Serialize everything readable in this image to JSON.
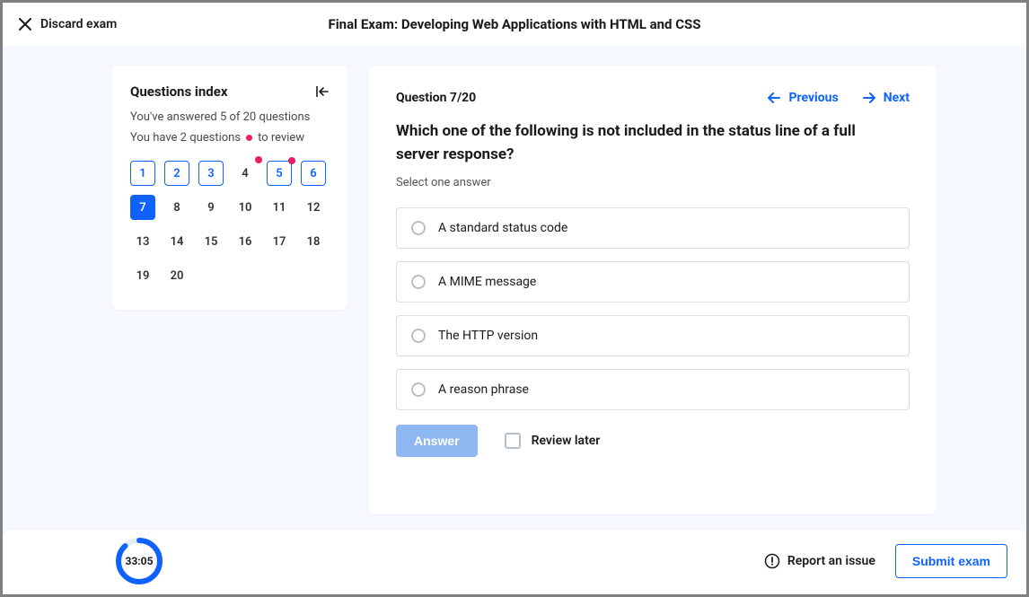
{
  "header": {
    "discard_label": "Discard exam",
    "title": "Final Exam: Developing Web Applications with HTML and CSS"
  },
  "sidebar": {
    "title": "Questions index",
    "progress_text": "You've answered 5 of 20 questions",
    "review_text_a": "You have 2 questions",
    "review_text_b": "to review",
    "cells": [
      {
        "n": "1",
        "answered": true,
        "current": false,
        "flag": false
      },
      {
        "n": "2",
        "answered": true,
        "current": false,
        "flag": false
      },
      {
        "n": "3",
        "answered": true,
        "current": false,
        "flag": false
      },
      {
        "n": "4",
        "answered": false,
        "current": false,
        "flag": true
      },
      {
        "n": "5",
        "answered": true,
        "current": false,
        "flag": true
      },
      {
        "n": "6",
        "answered": true,
        "current": false,
        "flag": false
      },
      {
        "n": "7",
        "answered": false,
        "current": true,
        "flag": false
      },
      {
        "n": "8",
        "answered": false,
        "current": false,
        "flag": false
      },
      {
        "n": "9",
        "answered": false,
        "current": false,
        "flag": false
      },
      {
        "n": "10",
        "answered": false,
        "current": false,
        "flag": false
      },
      {
        "n": "11",
        "answered": false,
        "current": false,
        "flag": false
      },
      {
        "n": "12",
        "answered": false,
        "current": false,
        "flag": false
      },
      {
        "n": "13",
        "answered": false,
        "current": false,
        "flag": false
      },
      {
        "n": "14",
        "answered": false,
        "current": false,
        "flag": false
      },
      {
        "n": "15",
        "answered": false,
        "current": false,
        "flag": false
      },
      {
        "n": "16",
        "answered": false,
        "current": false,
        "flag": false
      },
      {
        "n": "17",
        "answered": false,
        "current": false,
        "flag": false
      },
      {
        "n": "18",
        "answered": false,
        "current": false,
        "flag": false
      },
      {
        "n": "19",
        "answered": false,
        "current": false,
        "flag": false
      },
      {
        "n": "20",
        "answered": false,
        "current": false,
        "flag": false
      }
    ]
  },
  "question": {
    "counter": "Question 7/20",
    "prev_label": "Previous",
    "next_label": "Next",
    "text": "Which one of the following is not included in the status line of a full server response?",
    "instruction": "Select one answer",
    "options": [
      "A standard status code",
      "A MIME message",
      "The HTTP version",
      "A reason phrase"
    ],
    "answer_button": "Answer",
    "review_later": "Review later"
  },
  "footer": {
    "timer": "33:05",
    "timer_fraction": 0.88,
    "report_label": "Report an issue",
    "submit_label": "Submit exam"
  }
}
